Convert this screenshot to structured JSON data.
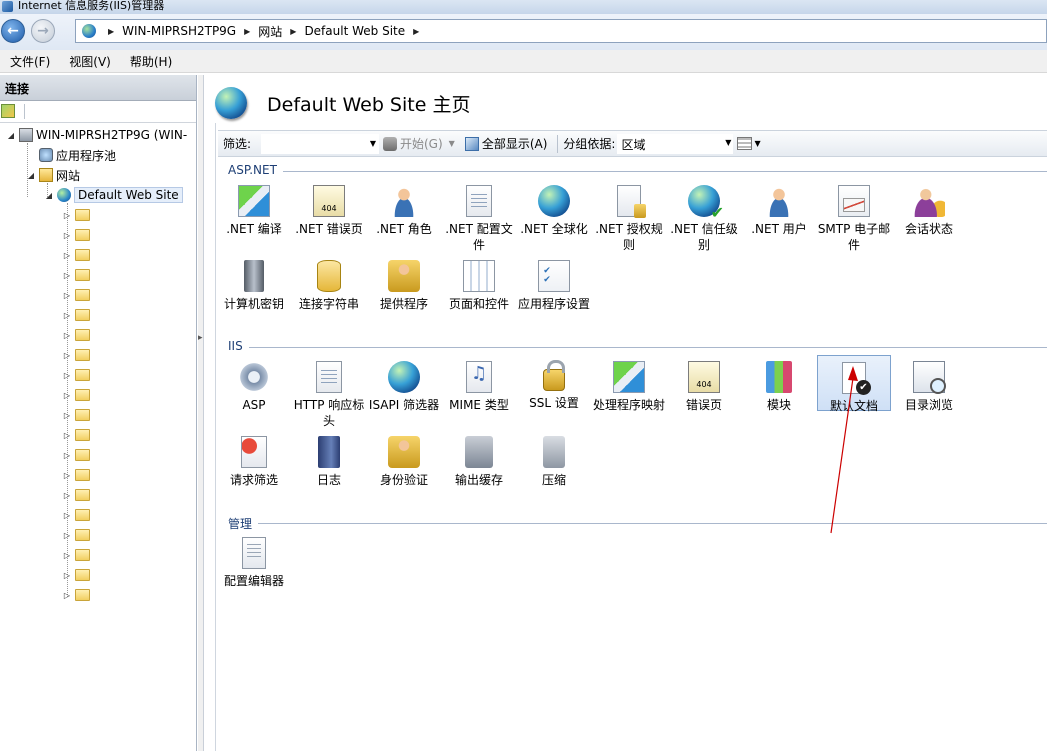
{
  "window": {
    "title": "Internet 信息服务(IIS)管理器"
  },
  "address": {
    "path": [
      "WIN-MIPRSH2TP9G",
      "网站",
      "Default Web Site"
    ]
  },
  "menu": [
    "文件(F)",
    "视图(V)",
    "帮助(H)"
  ],
  "connections": {
    "header": "连接",
    "tree": {
      "server": "WIN-MIPRSH2TP9G (WIN-",
      "app_pools": "应用程序池",
      "sites": "网站",
      "site": "Default Web Site",
      "folder_count": 20
    }
  },
  "page": {
    "title": "Default Web Site 主页"
  },
  "filter": {
    "label": "筛选:",
    "value": "",
    "start_label": "开始(G)",
    "show_all_label": "全部显示(A)",
    "group_by_label": "分组依据:",
    "group_by_value": "区域"
  },
  "sections": {
    "aspnet": {
      "label": "ASP.NET",
      "items": [
        {
          "label": ".NET 编译",
          "icon": "dotnet-compile-icon"
        },
        {
          "label": ".NET 错误页",
          "icon": "dotnet-error-pages-icon"
        },
        {
          "label": ".NET 角色",
          "icon": "dotnet-roles-icon"
        },
        {
          "label": ".NET 配置文件",
          "icon": "dotnet-profile-icon"
        },
        {
          "label": ".NET 全球化",
          "icon": "dotnet-globalization-icon"
        },
        {
          "label": ".NET 授权规则",
          "icon": "dotnet-authorization-icon"
        },
        {
          "label": ".NET 信任级别",
          "icon": "dotnet-trust-icon"
        },
        {
          "label": ".NET 用户",
          "icon": "dotnet-users-icon"
        },
        {
          "label": "SMTP 电子邮件",
          "icon": "smtp-email-icon"
        },
        {
          "label": "会话状态",
          "icon": "session-state-icon"
        },
        {
          "label": "计算机密钥",
          "icon": "machine-key-icon"
        },
        {
          "label": "连接字符串",
          "icon": "connection-strings-icon"
        },
        {
          "label": "提供程序",
          "icon": "providers-icon"
        },
        {
          "label": "页面和控件",
          "icon": "pages-controls-icon"
        },
        {
          "label": "应用程序设置",
          "icon": "app-settings-icon"
        }
      ]
    },
    "iis": {
      "label": "IIS",
      "items": [
        {
          "label": "ASP",
          "icon": "asp-icon"
        },
        {
          "label": "HTTP 响应标头",
          "icon": "http-headers-icon"
        },
        {
          "label": "ISAPI 筛选器",
          "icon": "isapi-filters-icon"
        },
        {
          "label": "MIME 类型",
          "icon": "mime-types-icon"
        },
        {
          "label": "SSL 设置",
          "icon": "ssl-settings-icon"
        },
        {
          "label": "处理程序映射",
          "icon": "handler-mappings-icon"
        },
        {
          "label": "错误页",
          "icon": "error-pages-icon"
        },
        {
          "label": "模块",
          "icon": "modules-icon"
        },
        {
          "label": "默认文档",
          "icon": "default-document-icon"
        },
        {
          "label": "目录浏览",
          "icon": "directory-browsing-icon"
        },
        {
          "label": "请求筛选",
          "icon": "request-filtering-icon"
        },
        {
          "label": "日志",
          "icon": "logging-icon"
        },
        {
          "label": "身份验证",
          "icon": "authentication-icon"
        },
        {
          "label": "输出缓存",
          "icon": "output-caching-icon"
        },
        {
          "label": "压缩",
          "icon": "compression-icon"
        }
      ]
    },
    "management": {
      "label": "管理",
      "items": [
        {
          "label": "配置编辑器",
          "icon": "configuration-editor-icon"
        }
      ]
    }
  },
  "colors": {
    "section_label": "#1e3f75",
    "selection_border": "#7da2ce",
    "annotation_arrow": "#cc0000"
  }
}
